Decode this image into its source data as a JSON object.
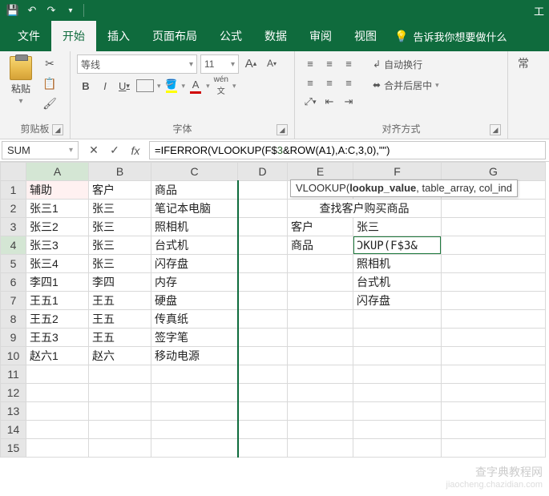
{
  "qat": {
    "title_right": "工",
    "undo": "↶",
    "redo": "↷"
  },
  "tabs": [
    "文件",
    "开始",
    "插入",
    "页面布局",
    "公式",
    "数据",
    "审阅",
    "视图"
  ],
  "active_tab_index": 1,
  "tellme": "告诉我你想要做什么",
  "ribbon": {
    "clipboard": {
      "paste": "粘贴",
      "label": "剪贴板"
    },
    "font": {
      "name": "等线",
      "size": "11",
      "label": "字体",
      "wen": "wén"
    },
    "align": {
      "wrap": "自动换行",
      "merge": "合并后居中",
      "label": "对齐方式"
    },
    "style_frag": "常"
  },
  "formula_bar": {
    "namebox": "SUM",
    "formula_prefix": "=IFERROR(VLOOKUP(F$",
    "formula_mid": "3",
    "formula_suffix": "&ROW(A1),A:C,3,0),\"\")",
    "tooltip_fn": "VLOOKUP(",
    "tooltip_bold": "lookup_value",
    "tooltip_rest": ", table_array, col_ind"
  },
  "columns": [
    "A",
    "B",
    "C",
    "D",
    "E",
    "F",
    "G"
  ],
  "rows": [
    [
      "辅助",
      "客户",
      "商品",
      "",
      "",
      "",
      ""
    ],
    [
      "张三1",
      "张三",
      "笔记本电脑",
      "",
      "查找客户购买商品",
      "",
      ""
    ],
    [
      "张三2",
      "张三",
      "照相机",
      "",
      "客户",
      "张三",
      ""
    ],
    [
      "张三3",
      "张三",
      "台式机",
      "",
      "商品",
      "ƆKUP(F$3&",
      ""
    ],
    [
      "张三4",
      "张三",
      "闪存盘",
      "",
      "",
      "照相机",
      ""
    ],
    [
      "李四1",
      "李四",
      "内存",
      "",
      "",
      "台式机",
      ""
    ],
    [
      "王五1",
      "王五",
      "硬盘",
      "",
      "",
      "闪存盘",
      ""
    ],
    [
      "王五2",
      "王五",
      "传真纸",
      "",
      "",
      "",
      ""
    ],
    [
      "王五3",
      "王五",
      "签字笔",
      "",
      "",
      "",
      ""
    ],
    [
      "赵六1",
      "赵六",
      "移动电源",
      "",
      "",
      "",
      ""
    ],
    [
      "",
      "",
      "",
      "",
      "",
      "",
      ""
    ],
    [
      "",
      "",
      "",
      "",
      "",
      "",
      ""
    ],
    [
      "",
      "",
      "",
      "",
      "",
      "",
      ""
    ],
    [
      "",
      "",
      "",
      "",
      "",
      "",
      ""
    ],
    [
      "",
      "",
      "",
      "",
      "",
      "",
      ""
    ]
  ],
  "watermark": {
    "main": "查字典教程网",
    "sub": "jiaocheng.chazidian.com"
  }
}
